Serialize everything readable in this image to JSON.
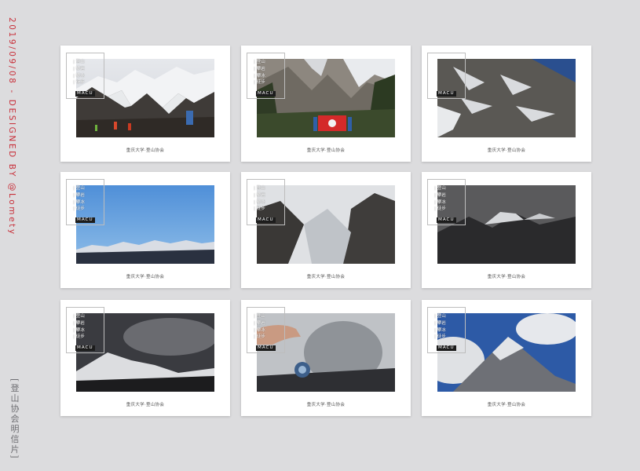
{
  "sidebar": {
    "date_designer": "2019/09/08 - DESIGNED BY @Lomety",
    "title": "[登山协会明信片]"
  },
  "colors": {
    "background": "#dcdcde",
    "accent_red": "#c8303a",
    "card": "#ffffff"
  },
  "postcards": [
    {
      "stamp_lines": [
        "| 登山",
        "| 攀岩",
        "| 攀冰",
        "| 徒步"
      ],
      "badge": "MACU",
      "caption": "重庆大学·登山协会",
      "photo": "glacier-climbers-photo"
    },
    {
      "stamp_lines": [
        "| 登山",
        "| 攀岩",
        "| 攀冰",
        "| 徒步"
      ],
      "badge": "MACU",
      "caption": "重庆大学·登山协会",
      "photo": "team-flag-photo"
    },
    {
      "stamp_lines": [
        "",
        "",
        "",
        ""
      ],
      "badge": "MACU",
      "caption": "重庆大学·登山协会",
      "photo": "rock-face-photo"
    },
    {
      "stamp_lines": [
        "| 登山",
        "| 攀岩",
        "| 攀冰",
        "| 徒步"
      ],
      "badge": "MACU",
      "caption": "重庆大学·登山协会",
      "photo": "blue-sky-range-photo"
    },
    {
      "stamp_lines": [
        "| 登山",
        "| 攀岩",
        "| 攀冰",
        "| 徒步"
      ],
      "badge": "MACU",
      "caption": "重庆大学·登山协会",
      "photo": "glacier-slope-photo"
    },
    {
      "stamp_lines": [
        "| 登山",
        "| 攀岩",
        "| 攀冰",
        "| 徒步"
      ],
      "badge": "MACU",
      "caption": "重庆大学·登山协会",
      "photo": "dark-peak-photo"
    },
    {
      "stamp_lines": [
        "| 登山",
        "| 攀岩",
        "| 攀冰",
        "| 徒步"
      ],
      "badge": "MACU",
      "caption": "重庆大学·登山协会",
      "photo": "cloudy-summit-photo"
    },
    {
      "stamp_lines": [
        "| 登山",
        "| 攀岩",
        "| 攀冰",
        "| 徒步"
      ],
      "badge": "MACU",
      "caption": "重庆大学·登山协会",
      "photo": "hand-medal-photo"
    },
    {
      "stamp_lines": [
        "| 登山",
        "| 攀岩",
        "| 攀冰",
        "| 徒步"
      ],
      "badge": "MACU",
      "caption": "重庆大学·登山协会",
      "photo": "blue-sky-peak-photo"
    }
  ]
}
